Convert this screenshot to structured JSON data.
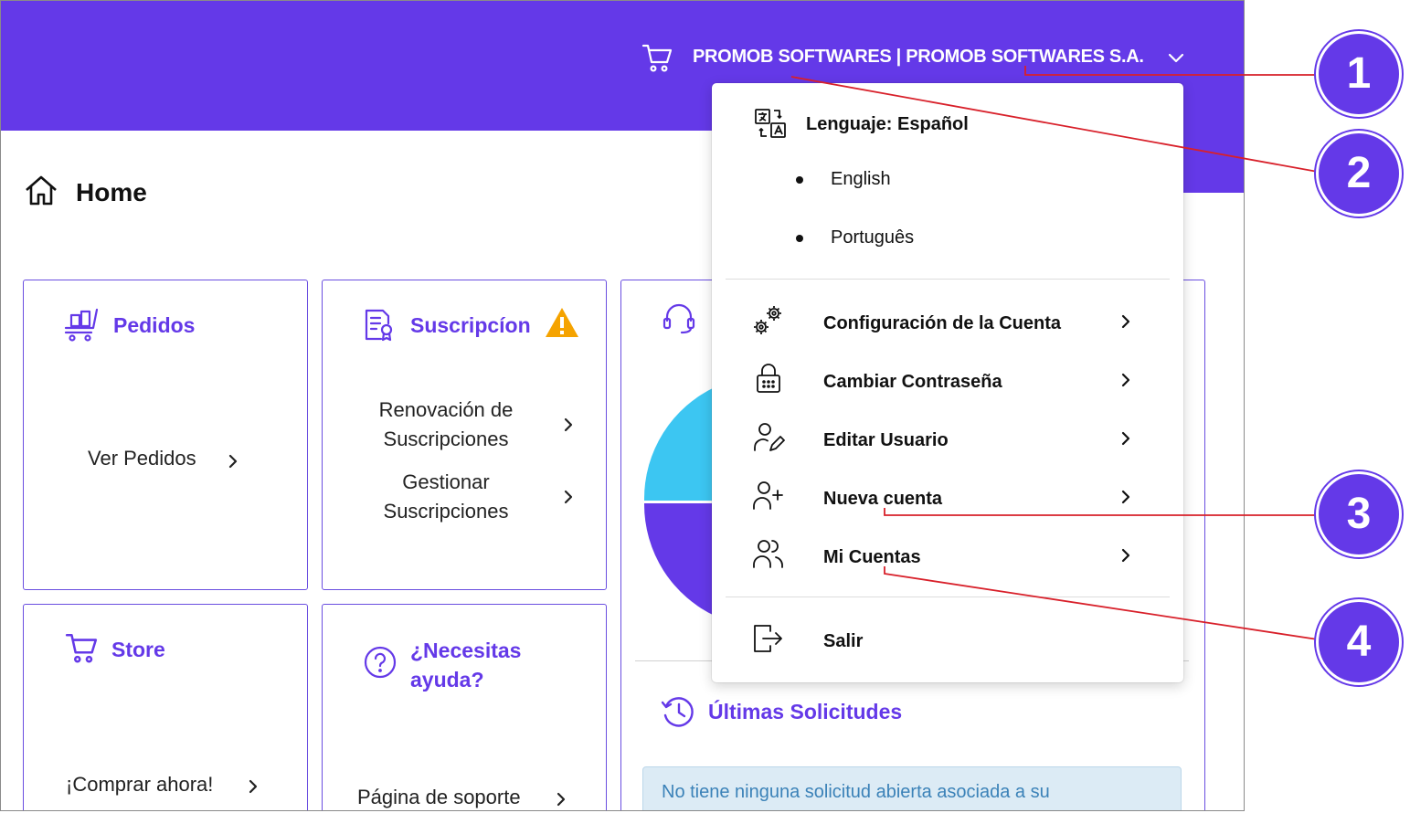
{
  "header": {
    "account_name": "PROMOB SOFTWARES | PROMOB SOFTWARES S.A.",
    "accent_color": "#6439e8"
  },
  "page": {
    "title": "Home"
  },
  "cards": {
    "pedidos": {
      "title": "Pedidos",
      "link": "Ver Pedidos"
    },
    "suscripcion": {
      "title": "Suscripcíon",
      "links": [
        "Renovación de Suscripciones",
        "Gestionar Suscripciones"
      ],
      "warning": true
    },
    "store": {
      "title": "Store",
      "link": "¡Comprar ahora!"
    },
    "ayuda": {
      "title": "¿Necesitas ayuda?",
      "link": "Página de soporte"
    },
    "support": {
      "latest_title": "Últimas Solicitudes",
      "info_text": "No tiene ninguna solicitud abierta asociada a su"
    }
  },
  "dropdown": {
    "language_label": "Lenguaje: Español",
    "languages": [
      "English",
      "Português"
    ],
    "items": [
      {
        "label": "Configuración de la Cuenta",
        "icon": "gears-icon"
      },
      {
        "label": "Cambiar Contraseña",
        "icon": "lock-icon"
      },
      {
        "label": "Editar Usuario",
        "icon": "user-edit-icon"
      },
      {
        "label": "Nueva cuenta",
        "icon": "user-plus-icon"
      },
      {
        "label": "Mi Cuentas",
        "icon": "users-icon"
      }
    ],
    "logout": "Salir"
  },
  "callouts": [
    "1",
    "2",
    "3",
    "4"
  ]
}
